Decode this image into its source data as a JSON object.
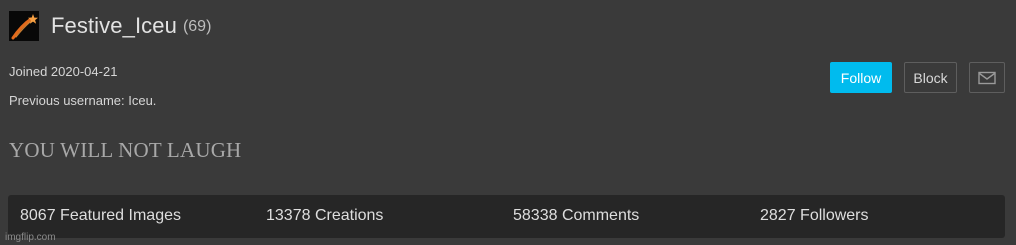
{
  "profile": {
    "username": "Festive_Iceu",
    "points": "(69)",
    "joined": "Joined 2020-04-21",
    "previous_username": "Previous username: Iceu.",
    "tagline": "YOU WILL NOT LAUGH",
    "avatar_icon": "shooting-star-icon"
  },
  "actions": {
    "follow_label": "Follow",
    "block_label": "Block",
    "message_icon": "envelope-icon"
  },
  "stats": {
    "featured": "8067 Featured Images",
    "creations": "13378 Creations",
    "comments": "58338 Comments",
    "followers": "2827 Followers"
  },
  "watermark": "imgflip.com",
  "colors": {
    "background": "#3a3a3a",
    "follow_button": "#00bbee",
    "stats_bar": "#262626"
  }
}
